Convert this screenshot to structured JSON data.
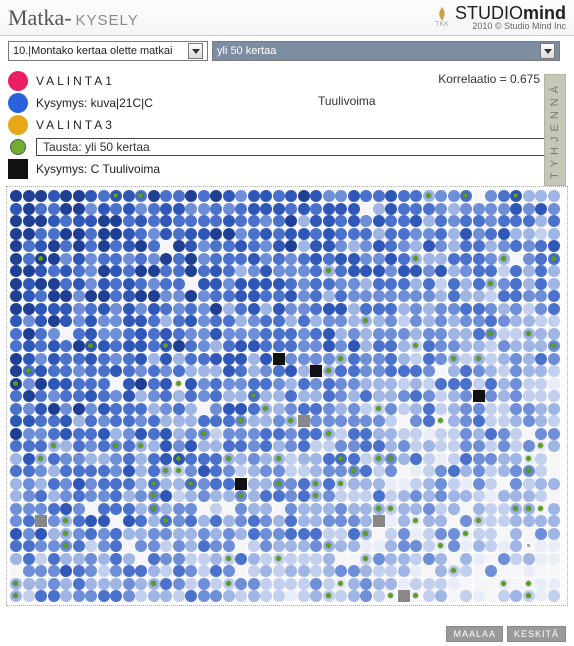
{
  "header": {
    "title_main": "Matka-",
    "title_sub": "KYSELY",
    "tkk": "TKK",
    "brand1a": "STUDIO",
    "brand1b": "mind",
    "brand2": "2010 © Studio Mind Inc"
  },
  "selectors": {
    "question": "10.|Montako kertaa olette matkai",
    "answer": "yli 50 kertaa"
  },
  "legend": {
    "correlation": "Korrelaatio = 0.675",
    "center": "Tuulivoima",
    "clear": "TYHJENNÄ",
    "items": [
      "VALINTA1",
      "Kysymys: kuva|21C|C",
      "VALINTA3",
      "Tausta: yli 50 kertaa",
      "Kysymys: C Tuulivoima"
    ]
  },
  "footer": {
    "b1": "MAALAA",
    "b2": "KESKITÄ"
  },
  "grid": {
    "cols": 44,
    "rows": 33,
    "palette": {
      "0": "#ffffff",
      "1": "#e8edf7",
      "2": "#c3d0ed",
      "3": "#9fb5e4",
      "4": "#6e8fd8",
      "5": "#4a72cc",
      "6": "#2f57b8",
      "7": "#1f3f94",
      "8": "#111111",
      "9": "#888888"
    },
    "green": "#5a9e1f",
    "seed": 918273
  }
}
